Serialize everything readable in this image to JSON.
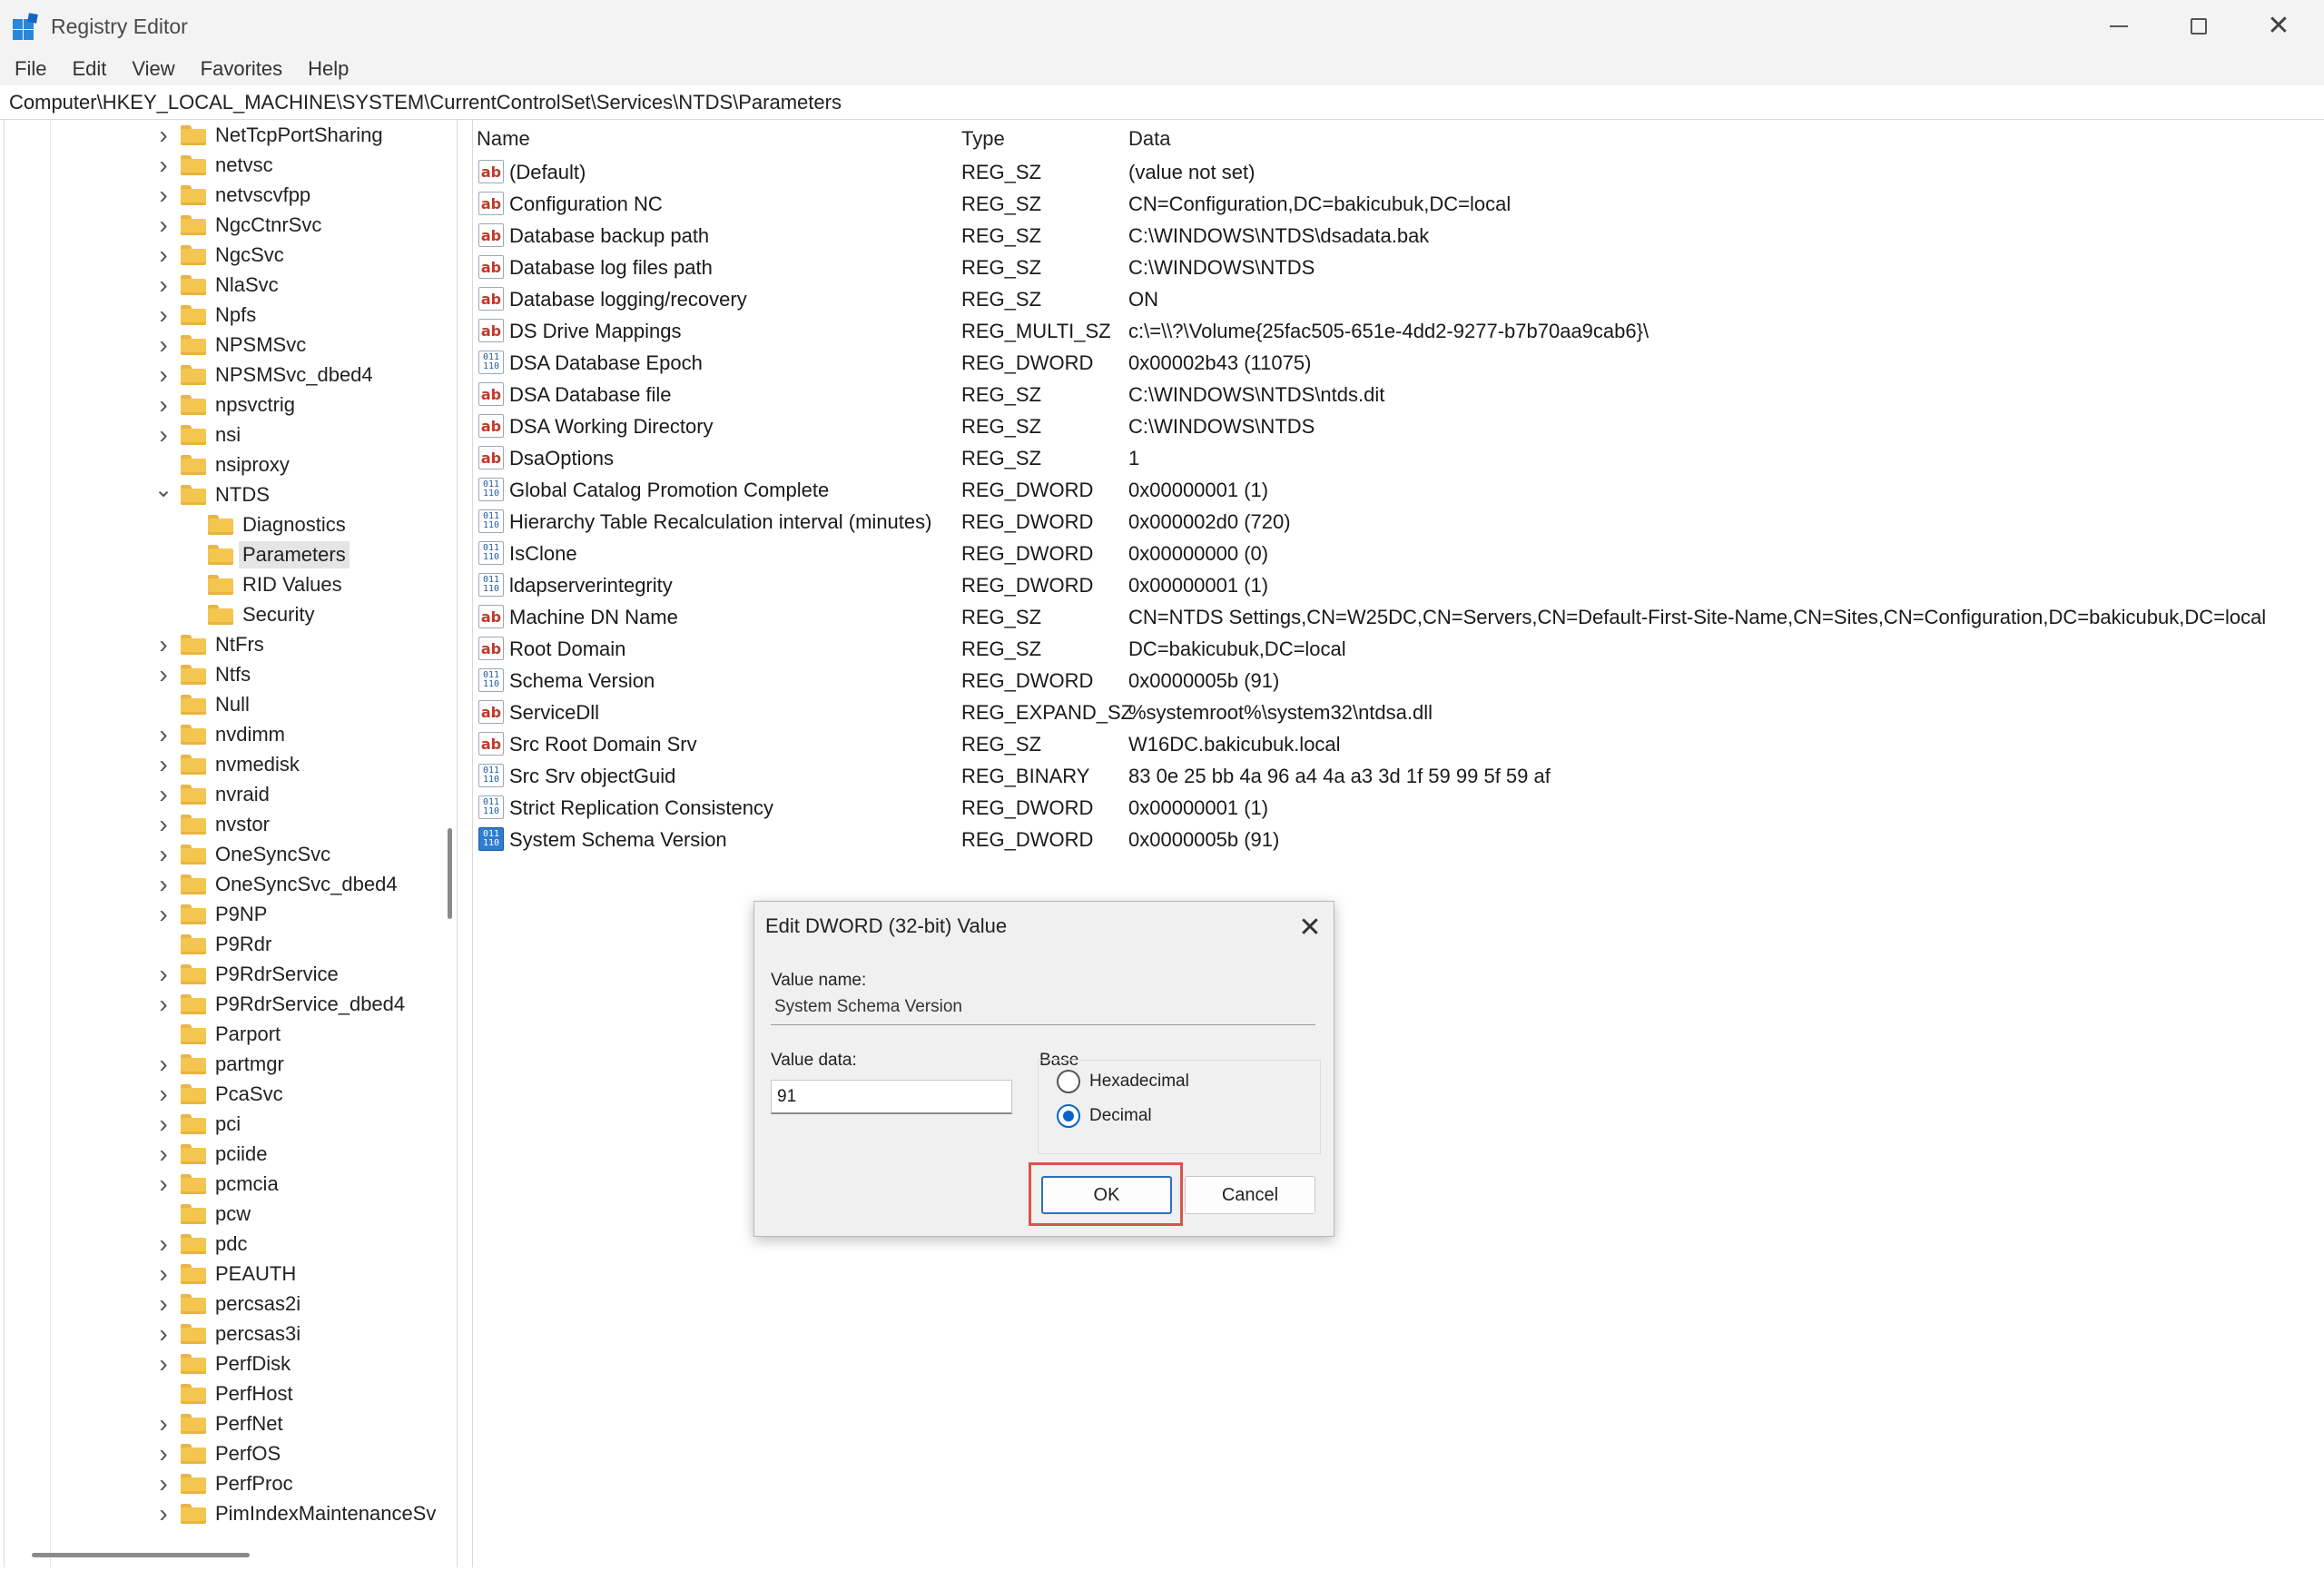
{
  "window": {
    "title": "Registry Editor"
  },
  "menu": [
    "File",
    "Edit",
    "View",
    "Favorites",
    "Help"
  ],
  "address": "Computer\\HKEY_LOCAL_MACHINE\\SYSTEM\\CurrentControlSet\\Services\\NTDS\\Parameters",
  "tree": {
    "items": [
      {
        "label": "NetTcpPortSharing",
        "expander": "collapsed",
        "depth": 0
      },
      {
        "label": "netvsc",
        "expander": "collapsed",
        "depth": 0
      },
      {
        "label": "netvscvfpp",
        "expander": "collapsed",
        "depth": 0
      },
      {
        "label": "NgcCtnrSvc",
        "expander": "collapsed",
        "depth": 0
      },
      {
        "label": "NgcSvc",
        "expander": "collapsed",
        "depth": 0
      },
      {
        "label": "NlaSvc",
        "expander": "collapsed",
        "depth": 0
      },
      {
        "label": "Npfs",
        "expander": "collapsed",
        "depth": 0
      },
      {
        "label": "NPSMSvc",
        "expander": "collapsed",
        "depth": 0
      },
      {
        "label": "NPSMSvc_dbed4",
        "expander": "collapsed",
        "depth": 0
      },
      {
        "label": "npsvctrig",
        "expander": "collapsed",
        "depth": 0
      },
      {
        "label": "nsi",
        "expander": "collapsed",
        "depth": 0
      },
      {
        "label": "nsiproxy",
        "expander": "none",
        "depth": 0
      },
      {
        "label": "NTDS",
        "expander": "expanded",
        "depth": 0
      },
      {
        "label": "Diagnostics",
        "expander": "none",
        "depth": 1
      },
      {
        "label": "Parameters",
        "expander": "none",
        "depth": 1,
        "selected": true
      },
      {
        "label": "RID Values",
        "expander": "none",
        "depth": 1
      },
      {
        "label": "Security",
        "expander": "none",
        "depth": 1
      },
      {
        "label": "NtFrs",
        "expander": "collapsed",
        "depth": 0
      },
      {
        "label": "Ntfs",
        "expander": "collapsed",
        "depth": 0
      },
      {
        "label": "Null",
        "expander": "none",
        "depth": 0
      },
      {
        "label": "nvdimm",
        "expander": "collapsed",
        "depth": 0
      },
      {
        "label": "nvmedisk",
        "expander": "collapsed",
        "depth": 0
      },
      {
        "label": "nvraid",
        "expander": "collapsed",
        "depth": 0
      },
      {
        "label": "nvstor",
        "expander": "collapsed",
        "depth": 0
      },
      {
        "label": "OneSyncSvc",
        "expander": "collapsed",
        "depth": 0
      },
      {
        "label": "OneSyncSvc_dbed4",
        "expander": "collapsed",
        "depth": 0
      },
      {
        "label": "P9NP",
        "expander": "collapsed",
        "depth": 0
      },
      {
        "label": "P9Rdr",
        "expander": "none",
        "depth": 0
      },
      {
        "label": "P9RdrService",
        "expander": "collapsed",
        "depth": 0
      },
      {
        "label": "P9RdrService_dbed4",
        "expander": "collapsed",
        "depth": 0
      },
      {
        "label": "Parport",
        "expander": "none",
        "depth": 0
      },
      {
        "label": "partmgr",
        "expander": "collapsed",
        "depth": 0
      },
      {
        "label": "PcaSvc",
        "expander": "collapsed",
        "depth": 0
      },
      {
        "label": "pci",
        "expander": "collapsed",
        "depth": 0
      },
      {
        "label": "pciide",
        "expander": "collapsed",
        "depth": 0
      },
      {
        "label": "pcmcia",
        "expander": "collapsed",
        "depth": 0
      },
      {
        "label": "pcw",
        "expander": "none",
        "depth": 0
      },
      {
        "label": "pdc",
        "expander": "collapsed",
        "depth": 0
      },
      {
        "label": "PEAUTH",
        "expander": "collapsed",
        "depth": 0
      },
      {
        "label": "percsas2i",
        "expander": "collapsed",
        "depth": 0
      },
      {
        "label": "percsas3i",
        "expander": "collapsed",
        "depth": 0
      },
      {
        "label": "PerfDisk",
        "expander": "collapsed",
        "depth": 0
      },
      {
        "label": "PerfHost",
        "expander": "none",
        "depth": 0
      },
      {
        "label": "PerfNet",
        "expander": "collapsed",
        "depth": 0
      },
      {
        "label": "PerfOS",
        "expander": "collapsed",
        "depth": 0
      },
      {
        "label": "PerfProc",
        "expander": "collapsed",
        "depth": 0
      },
      {
        "label": "PimIndexMaintenanceSv",
        "expander": "collapsed",
        "depth": 0
      }
    ]
  },
  "list": {
    "columns": {
      "name": "Name",
      "type": "Type",
      "data": "Data"
    },
    "rows": [
      {
        "icon": "string-value-icon",
        "name": "(Default)",
        "type": "REG_SZ",
        "data": "(value not set)"
      },
      {
        "icon": "string-value-icon",
        "name": "Configuration NC",
        "type": "REG_SZ",
        "data": "CN=Configuration,DC=bakicubuk,DC=local"
      },
      {
        "icon": "string-value-icon",
        "name": "Database backup path",
        "type": "REG_SZ",
        "data": "C:\\WINDOWS\\NTDS\\dsadata.bak"
      },
      {
        "icon": "string-value-icon",
        "name": "Database log files path",
        "type": "REG_SZ",
        "data": "C:\\WINDOWS\\NTDS"
      },
      {
        "icon": "string-value-icon",
        "name": "Database logging/recovery",
        "type": "REG_SZ",
        "data": "ON"
      },
      {
        "icon": "string-value-icon",
        "name": "DS Drive Mappings",
        "type": "REG_MULTI_SZ",
        "data": "c:\\=\\\\?\\Volume{25fac505-651e-4dd2-9277-b7b70aa9cab6}\\"
      },
      {
        "icon": "binary-value-icon",
        "name": "DSA Database Epoch",
        "type": "REG_DWORD",
        "data": "0x00002b43 (11075)"
      },
      {
        "icon": "string-value-icon",
        "name": "DSA Database file",
        "type": "REG_SZ",
        "data": "C:\\WINDOWS\\NTDS\\ntds.dit"
      },
      {
        "icon": "string-value-icon",
        "name": "DSA Working Directory",
        "type": "REG_SZ",
        "data": "C:\\WINDOWS\\NTDS"
      },
      {
        "icon": "string-value-icon",
        "name": "DsaOptions",
        "type": "REG_SZ",
        "data": "1"
      },
      {
        "icon": "binary-value-icon",
        "name": "Global Catalog Promotion Complete",
        "type": "REG_DWORD",
        "data": "0x00000001 (1)"
      },
      {
        "icon": "binary-value-icon",
        "name": "Hierarchy Table Recalculation interval (minutes)",
        "type": "REG_DWORD",
        "data": "0x000002d0 (720)"
      },
      {
        "icon": "binary-value-icon",
        "name": "IsClone",
        "type": "REG_DWORD",
        "data": "0x00000000 (0)"
      },
      {
        "icon": "binary-value-icon",
        "name": "ldapserverintegrity",
        "type": "REG_DWORD",
        "data": "0x00000001 (1)"
      },
      {
        "icon": "string-value-icon",
        "name": "Machine DN Name",
        "type": "REG_SZ",
        "data": "CN=NTDS Settings,CN=W25DC,CN=Servers,CN=Default-First-Site-Name,CN=Sites,CN=Configuration,DC=bakicubuk,DC=local"
      },
      {
        "icon": "string-value-icon",
        "name": "Root Domain",
        "type": "REG_SZ",
        "data": "DC=bakicubuk,DC=local"
      },
      {
        "icon": "binary-value-icon",
        "name": "Schema Version",
        "type": "REG_DWORD",
        "data": "0x0000005b (91)"
      },
      {
        "icon": "string-value-icon",
        "name": "ServiceDll",
        "type": "REG_EXPAND_SZ",
        "data": "%systemroot%\\system32\\ntdsa.dll"
      },
      {
        "icon": "string-value-icon",
        "name": "Src Root Domain Srv",
        "type": "REG_SZ",
        "data": "W16DC.bakicubuk.local"
      },
      {
        "icon": "binary-value-icon",
        "name": "Src Srv objectGuid",
        "type": "REG_BINARY",
        "data": "83 0e 25 bb 4a 96 a4 4a a3 3d 1f 59 99 5f 59 af"
      },
      {
        "icon": "binary-value-icon",
        "name": "Strict Replication Consistency",
        "type": "REG_DWORD",
        "data": "0x00000001 (1)"
      },
      {
        "icon": "binary-value-icon",
        "name": "System Schema Version",
        "type": "REG_DWORD",
        "data": "0x0000005b (91)",
        "selected": true
      }
    ]
  },
  "dialog": {
    "title": "Edit DWORD (32-bit) Value",
    "value_name_label": "Value name:",
    "value_name": "System Schema Version",
    "value_data_label": "Value data:",
    "value_data": "91",
    "base_label": "Base",
    "hex_label": "Hexadecimal",
    "dec_label": "Decimal",
    "selected_base": "Decimal",
    "ok_label": "OK",
    "cancel_label": "Cancel"
  },
  "colors": {
    "accent": "#0b63c8",
    "highlight_box": "#d9534f",
    "folder": "#f5c64f"
  }
}
